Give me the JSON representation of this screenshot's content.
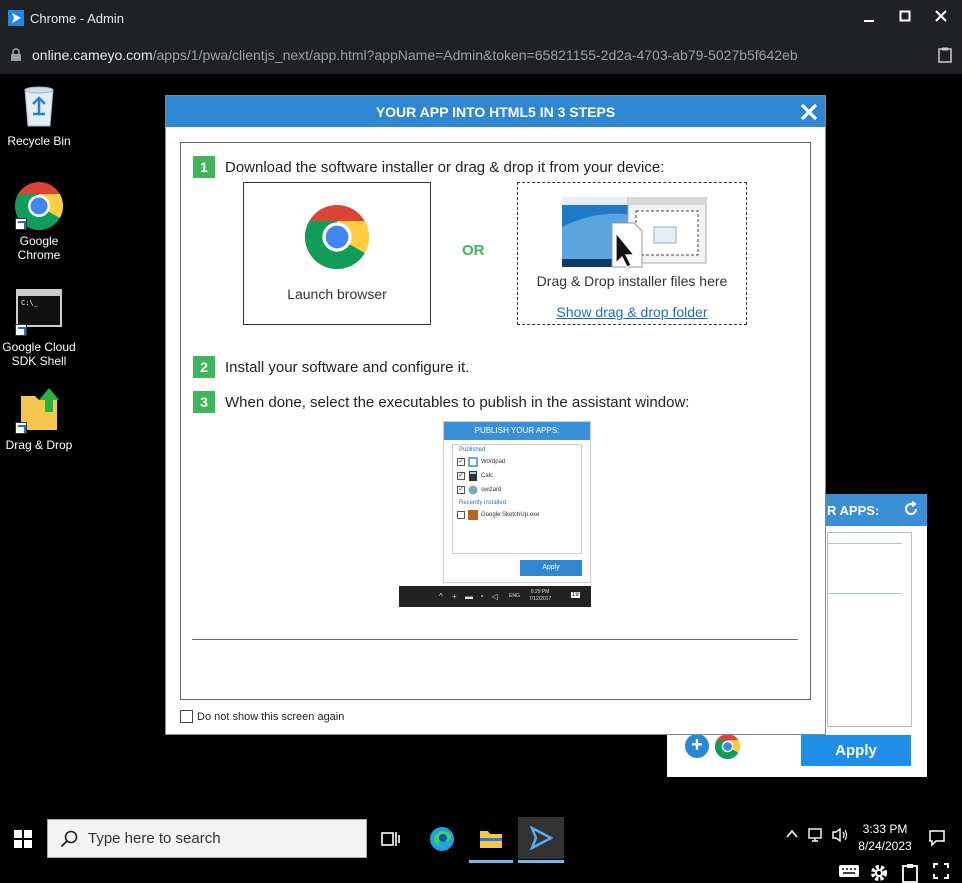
{
  "window": {
    "title": "Chrome - Admin",
    "url_host": "online.cameyo.com",
    "url_path": "/apps/1/pwa/clientjs_next/app.html?appName=Admin&token=65821155-2d2a-4703-ab79-5027b5f642eb"
  },
  "desktop": {
    "icons": [
      {
        "label": "Recycle Bin",
        "icon": "recycle-bin-icon"
      },
      {
        "label": "Google Chrome",
        "icon": "chrome-icon"
      },
      {
        "label": "Google Cloud SDK Shell",
        "icon": "terminal-icon"
      },
      {
        "label": "Drag & Drop",
        "icon": "folder-upload-icon"
      }
    ]
  },
  "background_panel": {
    "title": "R APPS:",
    "apply_label": "Apply"
  },
  "dialog": {
    "title": "YOUR APP INTO HTML5 IN 3 STEPS",
    "steps": [
      {
        "num": "1",
        "text": "Download the software installer or drag & drop it from your device:"
      },
      {
        "num": "2",
        "text": "Install your software and configure it."
      },
      {
        "num": "3",
        "text": "When done, select the executables to publish in the assistant window:"
      }
    ],
    "launch_label": "Launch browser",
    "or_label": "OR",
    "dnd_label": "Drag & Drop installer files here",
    "dnd_link": "Show drag & drop folder",
    "publish_preview": {
      "header": "PUBLISH YOUR APPS:",
      "published_label": "Published",
      "published": [
        "Wordpad",
        "Calc",
        "swizard"
      ],
      "recent_label": "Recently installed",
      "recent": [
        "Google SketchUp.exe"
      ],
      "apply": "Apply",
      "lang": "ENG",
      "time": "6:29 PM",
      "date": "7/12/2017",
      "notif_count": "19"
    },
    "dont_show_label": "Do not show this screen again"
  },
  "taskbar": {
    "search_placeholder": "Type here to search",
    "time": "3:33 PM",
    "date": "8/24/2023"
  },
  "colors": {
    "dialog_header": "#2f86d1",
    "step_green": "#3fb45c",
    "link_blue": "#1d6fb5",
    "apply_blue": "#1f8ee6"
  }
}
